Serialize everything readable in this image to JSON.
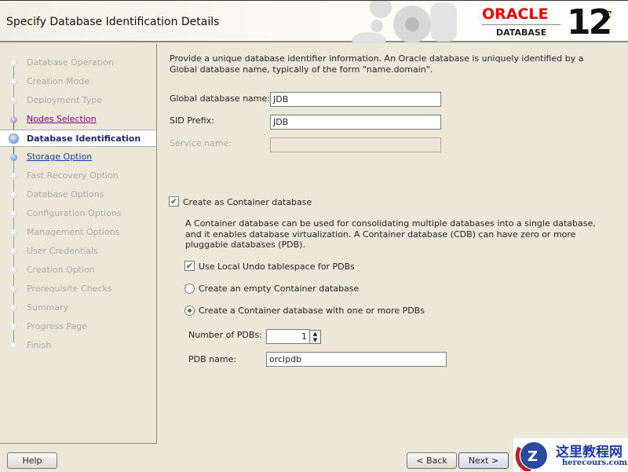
{
  "header": {
    "title": "Specify Database Identification Details",
    "logo_brand": "ORACLE",
    "logo_product": "DATABASE",
    "logo_version": "12",
    "logo_version_suffix": "c"
  },
  "steps": [
    {
      "label": "Database Operation",
      "state": "disabled"
    },
    {
      "label": "Creation Mode",
      "state": "disabled"
    },
    {
      "label": "Deployment Type",
      "state": "disabled"
    },
    {
      "label": "Nodes Selection",
      "state": "visited"
    },
    {
      "label": "Database Identification",
      "state": "current"
    },
    {
      "label": "Storage Option",
      "state": "next"
    },
    {
      "label": "Fast Recovery Option",
      "state": "disabled"
    },
    {
      "label": "Database Options",
      "state": "disabled"
    },
    {
      "label": "Configuration Options",
      "state": "disabled"
    },
    {
      "label": "Management Options",
      "state": "disabled"
    },
    {
      "label": "User Credentials",
      "state": "disabled"
    },
    {
      "label": "Creation Option",
      "state": "disabled"
    },
    {
      "label": "Prerequisite Checks",
      "state": "disabled"
    },
    {
      "label": "Summary",
      "state": "disabled"
    },
    {
      "label": "Progress Page",
      "state": "disabled"
    },
    {
      "label": "Finish",
      "state": "disabled"
    }
  ],
  "main": {
    "intro": "Provide a unique database identifier information. An Oracle database is uniquely identified by a Global database name, typically of the form \"name.domain\".",
    "global_db_label": "Global database name:",
    "global_db_value": "JDB",
    "sid_label": "SID Prefix:",
    "sid_value": "JDB",
    "service_label": "Service name:",
    "service_value": "",
    "cdb_label": "Create as Container database",
    "cdb_checked": true,
    "cdb_desc": "A Container database can be used for consolidating multiple databases into a single database, and it enables database virtualization. A Container database (CDB) can have zero or more pluggable databases (PDB).",
    "undo_label": "Use Local Undo tablespace for PDBs",
    "undo_checked": true,
    "empty_label": "Create an empty Container database",
    "withpdb_label": "Create a Container database with one or more PDBs",
    "num_pdbs_label": "Number of PDBs:",
    "num_pdbs_value": "1",
    "pdb_name_label": "PDB name:",
    "pdb_name_value": "orclpdb"
  },
  "footer": {
    "help": "Help",
    "back": "< Back",
    "next": "Next >"
  },
  "watermark": {
    "cn": "这里教程网",
    "url": "herecours.com"
  }
}
